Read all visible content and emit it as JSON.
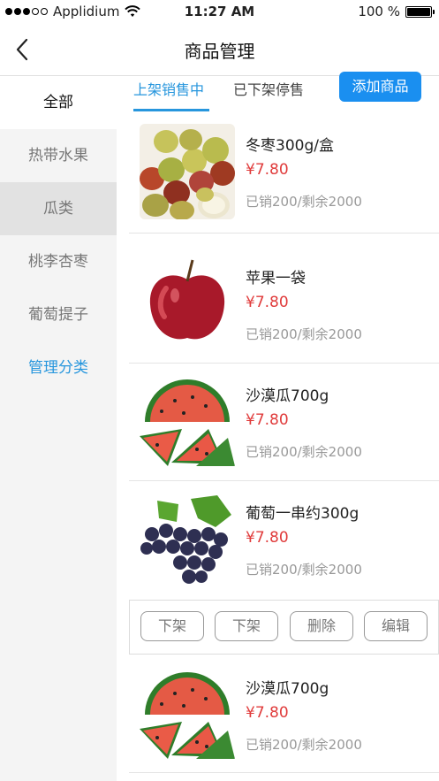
{
  "status_bar": {
    "carrier": "Applidium",
    "time": "11:27 AM",
    "battery": "100 %",
    "battery_level": 1.0,
    "signal_bars_filled": 3,
    "signal_bars_total": 5
  },
  "nav": {
    "title": "商品管理",
    "back_icon": "chevron-left-icon"
  },
  "sidebar": {
    "items": [
      {
        "label": "全部"
      },
      {
        "label": "热带水果"
      },
      {
        "label": "瓜类"
      },
      {
        "label": "桃李杏枣"
      },
      {
        "label": "葡萄提子"
      },
      {
        "label": "管理分类"
      }
    ]
  },
  "tabs": {
    "items": [
      {
        "label": "上架销售中"
      },
      {
        "label": "已下架停售"
      }
    ],
    "add_button": "添加商品"
  },
  "products": [
    {
      "name": "冬枣300g/盒",
      "price": "¥7.80",
      "stock": "已销200/剩余2000",
      "image": "jujube-image"
    },
    {
      "name": "苹果一袋",
      "price": "¥7.80",
      "stock": "已销200/剩余2000",
      "image": "apple-image"
    },
    {
      "name": "沙漠瓜700g",
      "price": "¥7.80",
      "stock": "已销200/剩余2000",
      "image": "watermelon-image"
    },
    {
      "name": "葡萄一串约300g",
      "price": "¥7.80",
      "stock": "已销200/剩余2000",
      "image": "grape-image"
    },
    {
      "name": "沙漠瓜700g",
      "price": "¥7.80",
      "stock": "已销200/剩余2000",
      "image": "watermelon-image"
    }
  ],
  "actions": {
    "buttons": [
      {
        "label": "下架"
      },
      {
        "label": "下架"
      },
      {
        "label": "删除"
      },
      {
        "label": "编辑"
      }
    ]
  },
  "colors": {
    "accent": "#2796dd",
    "button_blue": "#1a8ff0",
    "price_red": "#e03b3b",
    "sidebar_bg": "#f4f4f4"
  }
}
